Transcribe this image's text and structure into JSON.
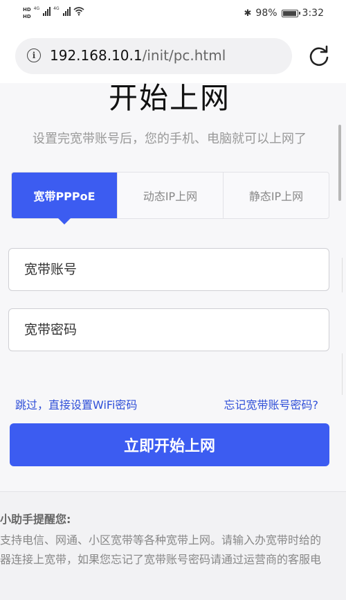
{
  "status_bar": {
    "hd1": "HD",
    "hd2": "HD",
    "net1": "4G",
    "net2": "4G",
    "battery_percent": "98%",
    "battery_level": 98,
    "time": "3:32"
  },
  "browser": {
    "url_host": "192.168.10.1",
    "url_path": "/init/pc.html"
  },
  "page": {
    "title": "开始上网",
    "subtitle": "设置完宽带账号后，您的手机、电脑就可以上网了",
    "tabs": [
      {
        "label": "宽带PPPoE",
        "active": true
      },
      {
        "label": "动态IP上网",
        "active": false
      },
      {
        "label": "静态IP上网",
        "active": false
      }
    ],
    "account_placeholder": "宽带账号",
    "password_placeholder": "宽带密码",
    "skip_link": "跳过，直接设置WiFi密码",
    "forgot_link": "忘记宽带账号密码?",
    "start_button": "立即开始上网"
  },
  "tips": {
    "title": "器小助手提醒您:",
    "line1": "器支持电信、网通、小区宽带等各种宽带上网。请输入办宽带时给的",
    "line2": "由器连接上宽带，如果您忘记了宽带账号密码请通过运营商的客服电"
  }
}
